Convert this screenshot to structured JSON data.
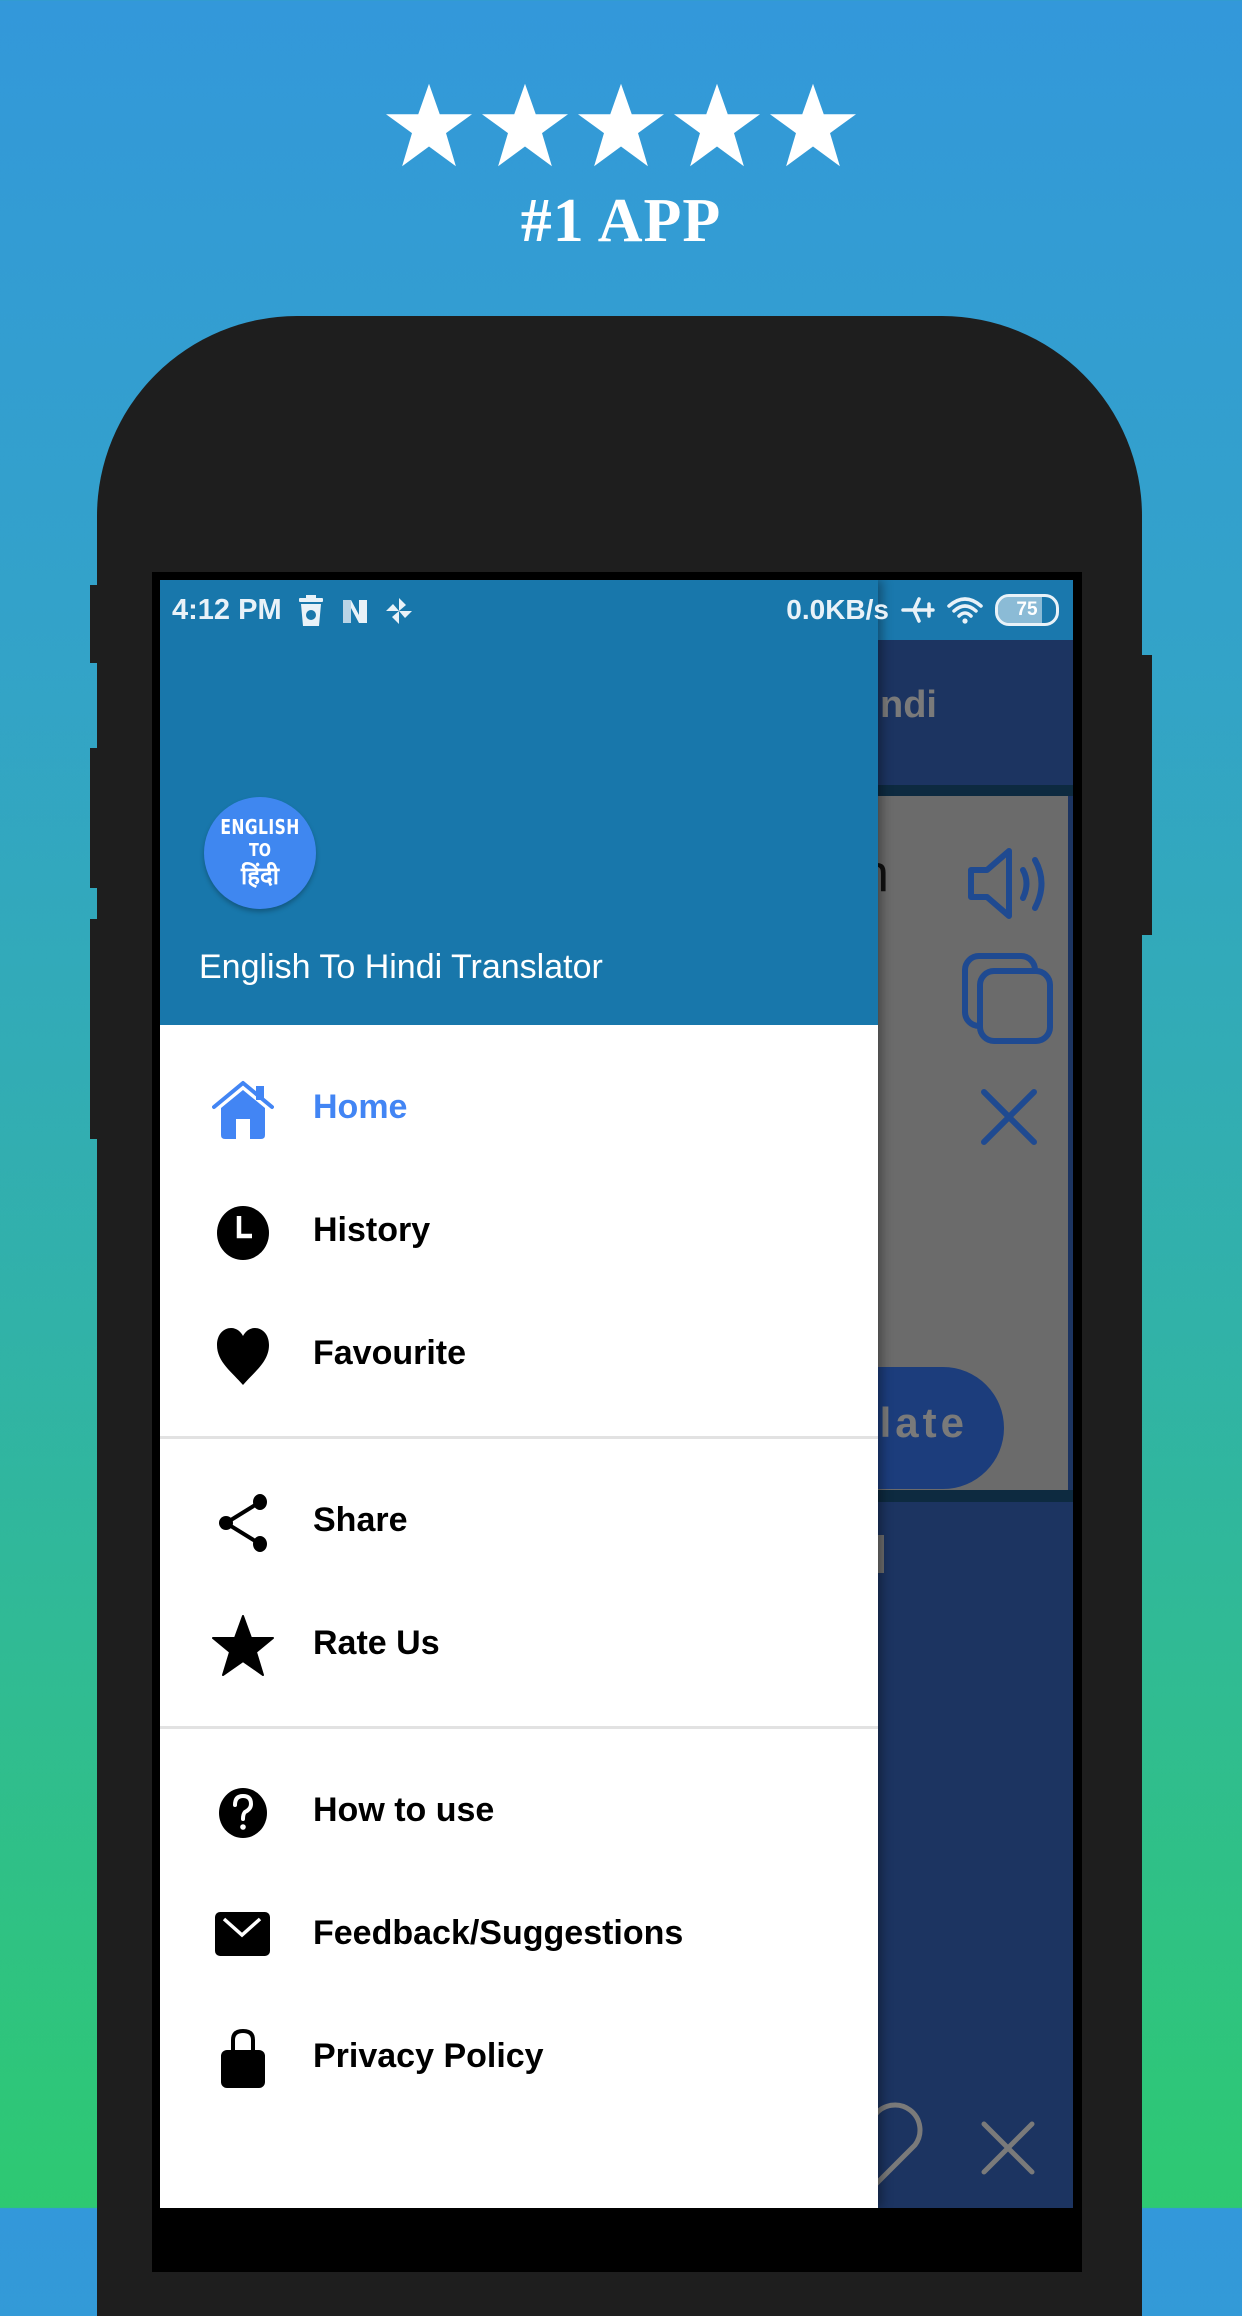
{
  "promo": {
    "rating_stars": 5,
    "tagline": "#1 APP"
  },
  "status_bar": {
    "time": "4:12 PM",
    "left_icons": [
      "android-cleaner-icon",
      "n-notification-icon",
      "pinwheel-icon"
    ],
    "network_speed": "0.0KB/s",
    "right_icons": [
      "airplane-mode-icon",
      "wifi-icon",
      "battery-icon"
    ],
    "battery_level": "75",
    "battery_percent": 75
  },
  "drawer": {
    "logo": {
      "line1": "ENGLISH",
      "line2": "TO",
      "line3": "हिंदी"
    },
    "app_name": "English To Hindi Translator",
    "groups": [
      [
        {
          "label": "Home",
          "icon": "home-icon",
          "active": true
        },
        {
          "label": "History",
          "icon": "clock-icon",
          "active": false
        },
        {
          "label": "Favourite",
          "icon": "heart-icon",
          "active": false
        }
      ],
      [
        {
          "label": "Share",
          "icon": "share-icon",
          "active": false
        },
        {
          "label": "Rate Us",
          "icon": "star-icon",
          "active": false
        }
      ],
      [
        {
          "label": "How to use",
          "icon": "help-icon",
          "active": false
        },
        {
          "label": "Feedback/Suggestions",
          "icon": "mail-icon",
          "active": false
        },
        {
          "label": "Privacy Policy",
          "icon": "lock-icon",
          "active": false
        }
      ]
    ]
  },
  "background_app": {
    "toolbar_title_visible": "Hindi",
    "input_text_visible": "h",
    "translate_button_visible": "late",
    "icons": [
      "speaker-icon",
      "copy-icon",
      "clear-icon",
      "favourite-outline-icon",
      "close-icon"
    ]
  },
  "colors": {
    "drawer_header": "#1877ab",
    "active_item": "#4285f4",
    "logo_bg": "#3f87f0",
    "app_toolbar": "#1c3461",
    "phone_body": "#1e1e1e"
  }
}
